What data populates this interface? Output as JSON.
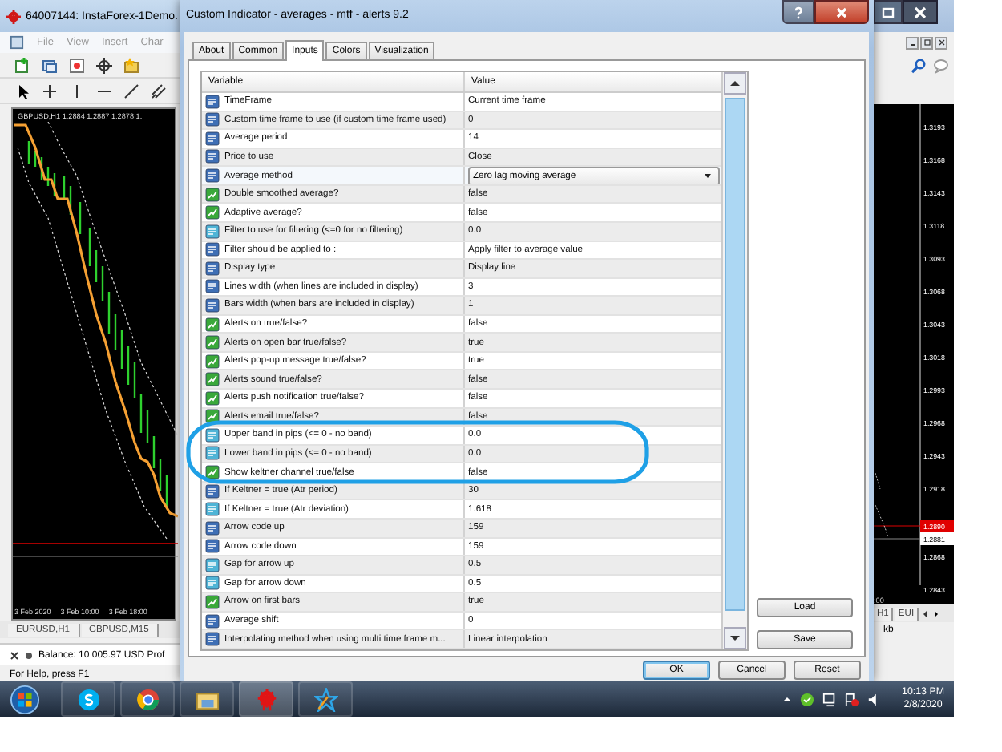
{
  "terminal_window": {
    "title": "64007144: InstaForex-1Demo.",
    "menu": [
      "File",
      "View",
      "Insert",
      "Char"
    ],
    "chart": {
      "header": "GBPUSD,H1  1.2884 1.2887 1.2878 1.",
      "time_labels_left": [
        "3 Feb 2020",
        "3 Feb 10:00",
        "3 Feb 18:00"
      ],
      "time_labels_right": [
        ":00"
      ],
      "price_labels": [
        "1.3193",
        "1.3168",
        "1.3143",
        "1.3118",
        "1.3093",
        "1.3068",
        "1.3043",
        "1.3018",
        "1.2993",
        "1.2968",
        "1.2943",
        "1.2918",
        "1.2868",
        "1.2843"
      ],
      "price_markers": [
        {
          "text": "1.2890",
          "kind": "bid"
        },
        {
          "text": "1.2881",
          "kind": "ask"
        }
      ]
    },
    "chart_tabs_left": [
      {
        "label": "EURUSD,H1",
        "selected": false
      },
      {
        "label": "GBPUSD,M15",
        "selected": false
      }
    ],
    "chart_tabs_right": [
      {
        "label": "H1",
        "selected": false
      },
      {
        "label": "EUI",
        "selected": false
      }
    ],
    "balance": "Balance: 10 005.97 USD  Prof",
    "status_left": "For Help, press F1",
    "status_right": "kb"
  },
  "dialog": {
    "title": "Custom Indicator - averages - mtf - alerts  9.2",
    "tabs": [
      {
        "label": "About",
        "selected": false
      },
      {
        "label": "Common",
        "selected": false
      },
      {
        "label": "Inputs",
        "selected": true
      },
      {
        "label": "Colors",
        "selected": false
      },
      {
        "label": "Visualization",
        "selected": false
      }
    ],
    "table": {
      "columns": [
        "Variable",
        "Value"
      ],
      "rows": [
        {
          "kind": "int",
          "variable": "TimeFrame",
          "value": "Current time frame",
          "selected": false
        },
        {
          "kind": "int",
          "variable": "Custom time frame to use (if custom time frame used)",
          "value": "0",
          "selected": false
        },
        {
          "kind": "int",
          "variable": "Average period",
          "value": "14",
          "selected": false
        },
        {
          "kind": "int",
          "variable": "Price to use",
          "value": "Close",
          "selected": false
        },
        {
          "kind": "int",
          "variable": "Average method",
          "value": "Zero lag moving average",
          "selected": true
        },
        {
          "kind": "bool",
          "variable": "Double smoothed average?",
          "value": "false",
          "selected": false
        },
        {
          "kind": "bool",
          "variable": "Adaptive average?",
          "value": "false",
          "selected": false
        },
        {
          "kind": "double",
          "variable": "Filter to use for filtering (<=0 for no filtering)",
          "value": "0.0",
          "selected": false
        },
        {
          "kind": "int",
          "variable": "Filter should be applied to :",
          "value": "Apply filter to average value",
          "selected": false
        },
        {
          "kind": "int",
          "variable": "Display type",
          "value": "Display line",
          "selected": false
        },
        {
          "kind": "int",
          "variable": "Lines width (when lines are included in display)",
          "value": "3",
          "selected": false
        },
        {
          "kind": "int",
          "variable": "Bars width (when bars are included in display)",
          "value": "1",
          "selected": false
        },
        {
          "kind": "bool",
          "variable": "Alerts on true/false?",
          "value": "false",
          "selected": false
        },
        {
          "kind": "bool",
          "variable": "Alerts on open bar true/false?",
          "value": "true",
          "selected": false
        },
        {
          "kind": "bool",
          "variable": "Alerts pop-up message true/false?",
          "value": "true",
          "selected": false
        },
        {
          "kind": "bool",
          "variable": "Alerts sound true/false?",
          "value": "false",
          "selected": false
        },
        {
          "kind": "bool",
          "variable": "Alerts push notification true/false?",
          "value": "false",
          "selected": false
        },
        {
          "kind": "bool",
          "variable": "Alerts email true/false?",
          "value": "false",
          "selected": false
        },
        {
          "kind": "double",
          "variable": "Upper band in pips (<= 0 - no band)",
          "value": "0.0",
          "selected": false
        },
        {
          "kind": "double",
          "variable": "Lower band in pips (<= 0 - no band)",
          "value": "0.0",
          "selected": false
        },
        {
          "kind": "bool",
          "variable": "Show keltner channel true/false",
          "value": "false",
          "selected": false
        },
        {
          "kind": "int",
          "variable": "If Keltner = true (Atr period)",
          "value": "30",
          "selected": false
        },
        {
          "kind": "double",
          "variable": "If Keltner = true (Atr deviation)",
          "value": "1.618",
          "selected": false
        },
        {
          "kind": "int",
          "variable": "Arrow code up",
          "value": "159",
          "selected": false
        },
        {
          "kind": "int",
          "variable": "Arrow code down",
          "value": "159",
          "selected": false
        },
        {
          "kind": "double",
          "variable": "Gap for arrow up",
          "value": "0.5",
          "selected": false
        },
        {
          "kind": "double",
          "variable": "Gap for arrow down",
          "value": "0.5",
          "selected": false
        },
        {
          "kind": "bool",
          "variable": "Arrow on first bars",
          "value": "true",
          "selected": false
        },
        {
          "kind": "int",
          "variable": "Average shift",
          "value": "0",
          "selected": false
        },
        {
          "kind": "int",
          "variable": "Interpolating method when using multi time frame m...",
          "value": "Linear interpolation",
          "selected": false
        }
      ]
    },
    "side_buttons": [
      "Load",
      "Save"
    ],
    "buttons": [
      {
        "label": "OK",
        "default": true
      },
      {
        "label": "Cancel",
        "default": false
      },
      {
        "label": "Reset",
        "default": false
      }
    ]
  },
  "taskbar": {
    "time": "10:13 PM",
    "date": "2/8/2020"
  }
}
